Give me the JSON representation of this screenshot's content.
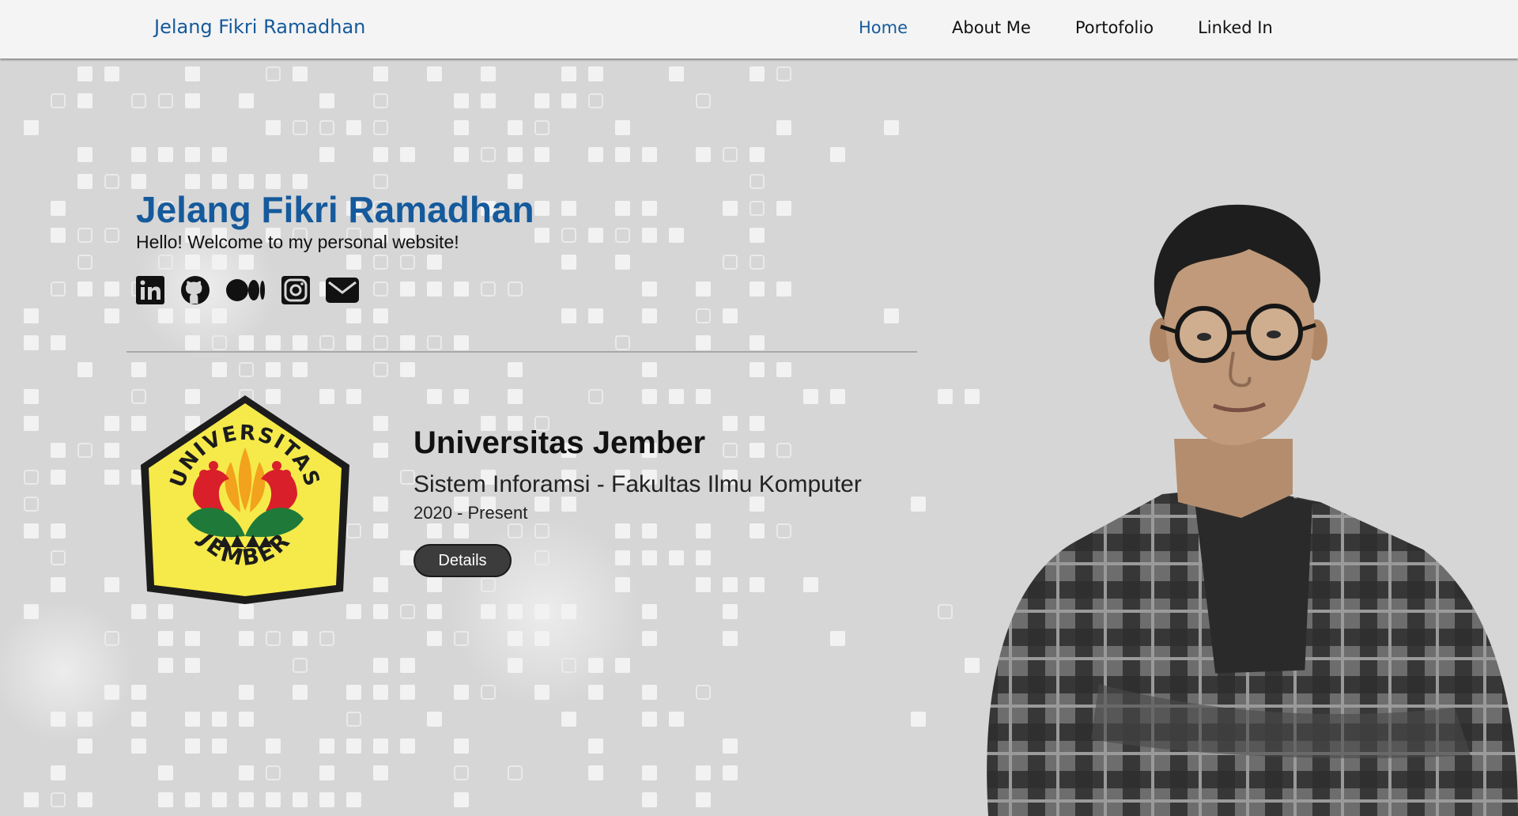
{
  "navbar": {
    "brand": "Jelang Fikri Ramadhan",
    "links": [
      {
        "label": "Home",
        "active": true
      },
      {
        "label": "About Me",
        "active": false
      },
      {
        "label": "Portofolio",
        "active": false
      },
      {
        "label": "Linked In",
        "active": false
      }
    ]
  },
  "hero": {
    "name": "Jelang Fikri Ramadhan",
    "greeting": "Hello! Welcome to my personal website!",
    "socials": [
      "linkedin-icon",
      "github-icon",
      "medium-icon",
      "instagram-icon",
      "mail-icon"
    ]
  },
  "education": {
    "logo_text_top": "UNIVERSITAS",
    "logo_text_bottom": "JEMBER",
    "institution": "Universitas Jember",
    "program": "Sistem Inforamsi - Fakultas Ilmu Komputer",
    "period": "2020 - Present",
    "details_label": "Details"
  },
  "colors": {
    "accent": "#155a9c",
    "background": "#d6d6d6",
    "navbar": "#f4f4f4",
    "button": "#3c3c3c"
  }
}
